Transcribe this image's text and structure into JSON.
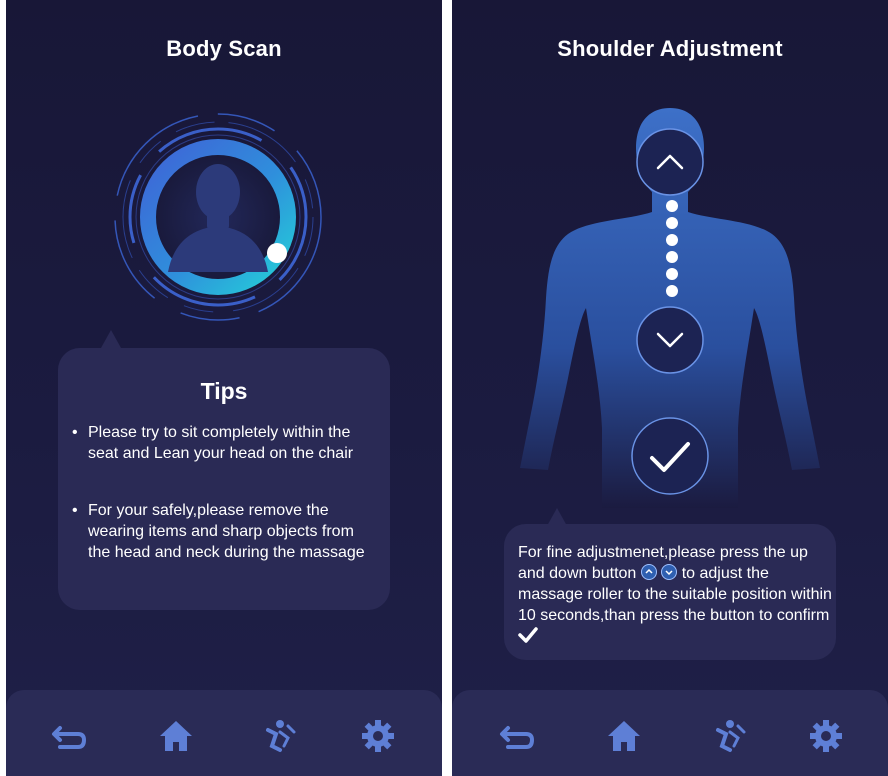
{
  "left_screen": {
    "title": "Body Scan",
    "tips": {
      "title": "Tips",
      "items": [
        "Please try to sit completely within the seat and Lean your head on the chair",
        "For your safely,please remove the wearing items and sharp objects from the head and neck during the massage"
      ]
    }
  },
  "right_screen": {
    "title": "Shoulder Adjustment",
    "instruction": {
      "part1": "For fine adjustmenet,please press the up and down button",
      "part2": "to adjust the massage roller to the suitable  position within 10 seconds,than press the button to confirm"
    }
  },
  "bottom_nav": {
    "icons": [
      "back-icon",
      "home-icon",
      "massage-icon",
      "gear-icon"
    ]
  },
  "colors": {
    "background": "#1b1b40",
    "card": "#2a2a55",
    "accent_blue": "#3a7fd8",
    "accent_cyan": "#28c8d8",
    "icon": "#5e7fd6"
  }
}
